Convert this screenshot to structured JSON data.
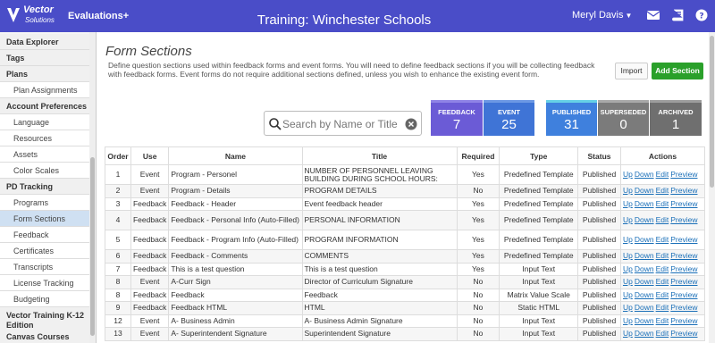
{
  "header": {
    "logo_line1": "Vector",
    "logo_line2": "Solutions",
    "app_name": "Evaluations+",
    "title": "Training: Winchester Schools",
    "user": "Meryl Davis",
    "icons": [
      "mail-icon",
      "book-icon",
      "help-icon"
    ]
  },
  "sidebar": {
    "items": [
      {
        "label": "Data Explorer",
        "type": "head"
      },
      {
        "label": "Tags",
        "type": "head"
      },
      {
        "label": "Plans",
        "type": "head"
      },
      {
        "label": "Plan Assignments",
        "type": "sub"
      },
      {
        "label": "Account Preferences",
        "type": "head"
      },
      {
        "label": "Language",
        "type": "sub"
      },
      {
        "label": "Resources",
        "type": "sub"
      },
      {
        "label": "Assets",
        "type": "sub"
      },
      {
        "label": "Color Scales",
        "type": "sub"
      },
      {
        "label": "PD Tracking",
        "type": "head"
      },
      {
        "label": "Programs",
        "type": "sub"
      },
      {
        "label": "Form Sections",
        "type": "sub",
        "active": true
      },
      {
        "label": "Feedback",
        "type": "sub"
      },
      {
        "label": "Certificates",
        "type": "sub"
      },
      {
        "label": "Transcripts",
        "type": "sub"
      },
      {
        "label": "License Tracking",
        "type": "sub"
      },
      {
        "label": "Budgeting",
        "type": "sub"
      },
      {
        "label": "Vector Training K-12 Edition",
        "type": "head",
        "two_line": true
      },
      {
        "label": "Canvas Courses",
        "type": "head"
      }
    ]
  },
  "main": {
    "title": "Form Sections",
    "description": "Define question sections used within feedback forms and event forms. You will need to define feedback sections if you will be collecting feedback with feedback forms. Event forms do not require additional sections defined, unless you wish to enhance the existing event form.",
    "import_label": "Import",
    "add_label": "Add Section",
    "search_placeholder": "Search by Name or Title"
  },
  "tiles": [
    {
      "caption": "FEEDBACK",
      "count": "7",
      "color": "#6b5bd6",
      "bar": "#8f83e6"
    },
    {
      "caption": "EVENT",
      "count": "25",
      "color": "#3f74d6",
      "bar": "#6c98e4"
    },
    {
      "caption": "PUBLISHED",
      "count": "31",
      "color": "#3f80dd",
      "bar": "#66d0e6"
    },
    {
      "caption": "SUPERSEDED",
      "count": "0",
      "color": "#7b7b7b",
      "bar": "#a9a9a9"
    },
    {
      "caption": "ARCHIVED",
      "count": "1",
      "color": "#6f6f6f",
      "bar": "#9d9d9d"
    }
  ],
  "table": {
    "columns": [
      "Order",
      "Use",
      "Name",
      "Title",
      "Required",
      "Type",
      "Status",
      "Actions"
    ],
    "actions": [
      "Up",
      "Down",
      "Edit",
      "Preview"
    ],
    "rows": [
      {
        "order": "1",
        "use": "Event",
        "name": "Program - Personel",
        "title": "NUMBER OF PERSONNEL LEAVING BUILDING DURING SCHOOL HOURS:",
        "required": "Yes",
        "type": "Predefined Template",
        "status": "Published",
        "tall": true
      },
      {
        "order": "2",
        "use": "Event",
        "name": "Program - Details",
        "title": "PROGRAM DETAILS",
        "required": "No",
        "type": "Predefined Template",
        "status": "Published"
      },
      {
        "order": "3",
        "use": "Feedback",
        "name": "Feedback - Header",
        "title": "Event feedback header",
        "required": "Yes",
        "type": "Predefined Template",
        "status": "Published"
      },
      {
        "order": "4",
        "use": "Feedback",
        "name": "Feedback - Personal Info (Auto-Filled)",
        "title": "PERSONAL INFORMATION",
        "required": "Yes",
        "type": "Predefined Template",
        "status": "Published",
        "tall": true
      },
      {
        "order": "5",
        "use": "Feedback",
        "name": "Feedback - Program Info (Auto-Filled)",
        "title": "PROGRAM INFORMATION",
        "required": "Yes",
        "type": "Predefined Template",
        "status": "Published",
        "tall": true
      },
      {
        "order": "6",
        "use": "Feedback",
        "name": "Feedback - Comments",
        "title": "COMMENTS",
        "required": "Yes",
        "type": "Predefined Template",
        "status": "Published"
      },
      {
        "order": "7",
        "use": "Feedback",
        "name": "This is a test question",
        "title": "This is a test question",
        "required": "Yes",
        "type": "Input Text",
        "status": "Published"
      },
      {
        "order": "8",
        "use": "Event",
        "name": "A-Curr Sign",
        "title": "Director of Curriculum Signature",
        "required": "No",
        "type": "Input Text",
        "status": "Published"
      },
      {
        "order": "8",
        "use": "Feedback",
        "name": "Feedback",
        "title": "Feedback",
        "required": "No",
        "type": "Matrix Value Scale",
        "status": "Published"
      },
      {
        "order": "9",
        "use": "Feedback",
        "name": "Feedback HTML",
        "title": "HTML",
        "required": "No",
        "type": "Static HTML",
        "status": "Published"
      },
      {
        "order": "12",
        "use": "Event",
        "name": "A- Business Admin",
        "title": "A- Business Admin Signature",
        "required": "No",
        "type": "Input Text",
        "status": "Published"
      },
      {
        "order": "13",
        "use": "Event",
        "name": "A- Superintendent Signature",
        "title": "Superintendent Signature",
        "required": "No",
        "type": "Input Text",
        "status": "Published"
      }
    ]
  }
}
